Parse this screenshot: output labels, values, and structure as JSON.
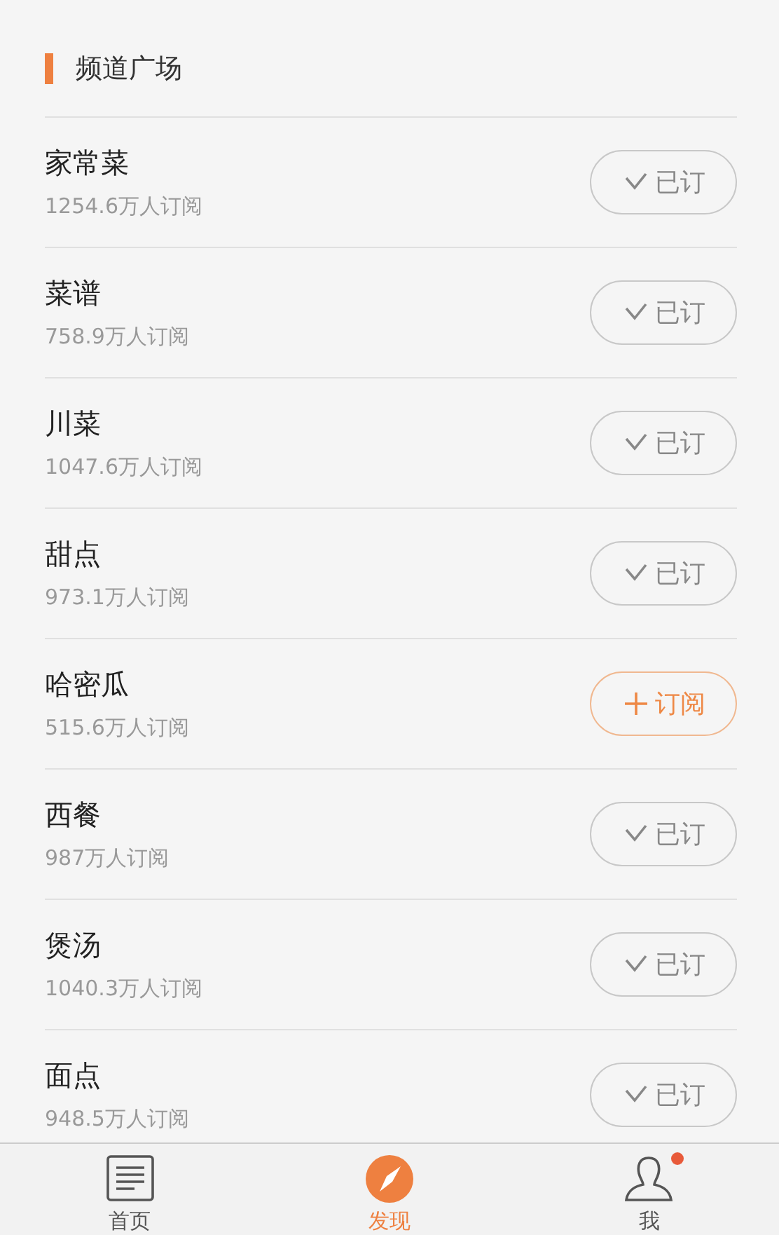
{
  "section_title": "频道广场",
  "channels": [
    {
      "name": "家常菜",
      "subscribers": "1254.6万人订阅",
      "subscribed": true,
      "button_label": "已订"
    },
    {
      "name": "菜谱",
      "subscribers": "758.9万人订阅",
      "subscribed": true,
      "button_label": "已订"
    },
    {
      "name": "川菜",
      "subscribers": "1047.6万人订阅",
      "subscribed": true,
      "button_label": "已订"
    },
    {
      "name": "甜点",
      "subscribers": "973.1万人订阅",
      "subscribed": true,
      "button_label": "已订"
    },
    {
      "name": "哈密瓜",
      "subscribers": "515.6万人订阅",
      "subscribed": false,
      "button_label": "订阅"
    },
    {
      "name": "西餐",
      "subscribers": "987万人订阅",
      "subscribed": true,
      "button_label": "已订"
    },
    {
      "name": "煲汤",
      "subscribers": "1040.3万人订阅",
      "subscribed": true,
      "button_label": "已订"
    },
    {
      "name": "面点",
      "subscribers": "948.5万人订阅",
      "subscribed": true,
      "button_label": "已订"
    }
  ],
  "tab_bar": [
    {
      "kind": "home",
      "label": "首页",
      "selected": false,
      "dot": false
    },
    {
      "kind": "discover",
      "label": "发现",
      "selected": true,
      "dot": false
    },
    {
      "kind": "me",
      "label": "我",
      "selected": false,
      "dot": true
    }
  ]
}
